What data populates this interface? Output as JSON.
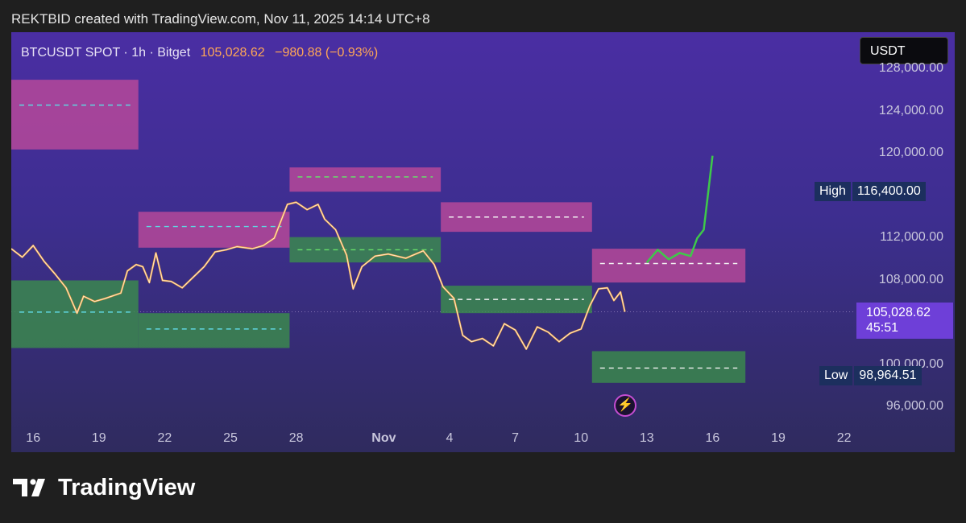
{
  "header": {
    "credit": "REKTBID created with TradingView.com, Nov 11, 2025 14:14 UTC+8"
  },
  "ticker": {
    "symbol": "BTCUSDT SPOT · 1h · Bitget",
    "price": "105,028.62",
    "change": "−980.88 (−0.93%)"
  },
  "currency_button": "USDT",
  "footer": {
    "brand": "TradingView"
  },
  "colors": {
    "bull": "#3b8f4a",
    "bear": "#c04a9a",
    "candle_up": "#ffffff",
    "candle_down": "#f5a742",
    "projection": "#3ec94a",
    "price_tag": "#6e3fd8"
  },
  "chart_data": {
    "type": "line",
    "title": "BTCUSDT SPOT · 1h · Bitget",
    "x_unit": "days from Oct 15, 2025",
    "ylim": [
      95000,
      129000
    ],
    "y_ticks": [
      {
        "value": 128000,
        "label": "128,000.00"
      },
      {
        "value": 124000,
        "label": "124,000.00"
      },
      {
        "value": 120000,
        "label": "120,000.00"
      },
      {
        "value": 112000,
        "label": "112,000.00"
      },
      {
        "value": 108000,
        "label": "108,000.00"
      },
      {
        "value": 100000,
        "label": "100,000.00"
      },
      {
        "value": 96000,
        "label": "96,000.00"
      }
    ],
    "x_ticks": [
      {
        "day": 1,
        "label": "16"
      },
      {
        "day": 4,
        "label": "19"
      },
      {
        "day": 7,
        "label": "22"
      },
      {
        "day": 10,
        "label": "25"
      },
      {
        "day": 13,
        "label": "28"
      },
      {
        "day": 17,
        "label": "Nov"
      },
      {
        "day": 20,
        "label": "4"
      },
      {
        "day": 23,
        "label": "7"
      },
      {
        "day": 26,
        "label": "10"
      },
      {
        "day": 29,
        "label": "13"
      },
      {
        "day": 32,
        "label": "16"
      },
      {
        "day": 35,
        "label": "19"
      },
      {
        "day": 38,
        "label": "22"
      }
    ],
    "price_series": [
      [
        0,
        111000
      ],
      [
        0.5,
        110200
      ],
      [
        1,
        111300
      ],
      [
        1.5,
        109800
      ],
      [
        2,
        108600
      ],
      [
        2.5,
        107300
      ],
      [
        3,
        104900
      ],
      [
        3.3,
        106500
      ],
      [
        3.8,
        106000
      ],
      [
        4.3,
        106300
      ],
      [
        5,
        106800
      ],
      [
        5.3,
        108900
      ],
      [
        5.7,
        109500
      ],
      [
        6,
        109300
      ],
      [
        6.3,
        107800
      ],
      [
        6.6,
        110600
      ],
      [
        6.9,
        108000
      ],
      [
        7.3,
        107900
      ],
      [
        7.8,
        107300
      ],
      [
        8.3,
        108300
      ],
      [
        8.8,
        109300
      ],
      [
        9.3,
        110700
      ],
      [
        9.8,
        110900
      ],
      [
        10.3,
        111200
      ],
      [
        11,
        111000
      ],
      [
        11.5,
        111300
      ],
      [
        12,
        112000
      ],
      [
        12.6,
        115200
      ],
      [
        13,
        115400
      ],
      [
        13.5,
        114700
      ],
      [
        14,
        115200
      ],
      [
        14.3,
        113800
      ],
      [
        14.8,
        112800
      ],
      [
        15.3,
        110400
      ],
      [
        15.6,
        107200
      ],
      [
        16,
        109300
      ],
      [
        16.6,
        110300
      ],
      [
        17.2,
        110500
      ],
      [
        18,
        110100
      ],
      [
        18.8,
        110800
      ],
      [
        19.3,
        109500
      ],
      [
        19.7,
        107400
      ],
      [
        20.2,
        106300
      ],
      [
        20.6,
        102800
      ],
      [
        21,
        102200
      ],
      [
        21.5,
        102500
      ],
      [
        22,
        101800
      ],
      [
        22.5,
        103900
      ],
      [
        23,
        103300
      ],
      [
        23.5,
        101500
      ],
      [
        24,
        103600
      ],
      [
        24.5,
        103100
      ],
      [
        25,
        102200
      ],
      [
        25.5,
        103000
      ],
      [
        26,
        103400
      ],
      [
        26.4,
        105600
      ],
      [
        26.8,
        107200
      ],
      [
        27.2,
        107300
      ],
      [
        27.5,
        106100
      ],
      [
        27.8,
        106900
      ],
      [
        28,
        105030
      ]
    ],
    "projection": [
      [
        29,
        109700
      ],
      [
        29.5,
        110900
      ],
      [
        30,
        110000
      ],
      [
        30.5,
        110600
      ],
      [
        31,
        110300
      ],
      [
        31.3,
        112000
      ],
      [
        31.6,
        112800
      ],
      [
        32,
        119800
      ]
    ],
    "zones": [
      {
        "kind": "supply",
        "d0": 0,
        "d1": 5.8,
        "top": 127000,
        "bottom": 120400,
        "mid": 124600
      },
      {
        "kind": "supply",
        "d0": 5.8,
        "d1": 12.7,
        "top": 114500,
        "bottom": 111100,
        "mid": 113100
      },
      {
        "kind": "supply",
        "d0": 12.7,
        "d1": 19.6,
        "top": 118700,
        "bottom": 116400,
        "mid": 117800
      },
      {
        "kind": "supply",
        "d0": 19.6,
        "d1": 26.5,
        "top": 115400,
        "bottom": 112600,
        "mid": 114000
      },
      {
        "kind": "supply",
        "d0": 26.5,
        "d1": 33.5,
        "top": 111000,
        "bottom": 107800,
        "mid": 109600
      },
      {
        "kind": "demand",
        "d0": 0,
        "d1": 5.8,
        "top": 108000,
        "bottom": 101600,
        "mid": 105000
      },
      {
        "kind": "demand",
        "d0": 5.8,
        "d1": 12.7,
        "top": 104900,
        "bottom": 101600,
        "mid": 103400
      },
      {
        "kind": "demand",
        "d0": 12.7,
        "d1": 19.6,
        "top": 112100,
        "bottom": 109700,
        "mid": 110900
      },
      {
        "kind": "demand",
        "d0": 19.6,
        "d1": 26.5,
        "top": 107500,
        "bottom": 104900,
        "mid": 106200
      },
      {
        "kind": "demand",
        "d0": 26.5,
        "d1": 33.5,
        "top": 101300,
        "bottom": 98300,
        "mid": 99700
      }
    ],
    "high": {
      "label": "High",
      "value": 116400,
      "value_label": "116,400.00"
    },
    "low": {
      "label": "Low",
      "value": 98964.51,
      "value_label": "98,964.51"
    },
    "current": {
      "value": 105028.62,
      "value_label": "105,028.62",
      "countdown": "45:51"
    }
  }
}
